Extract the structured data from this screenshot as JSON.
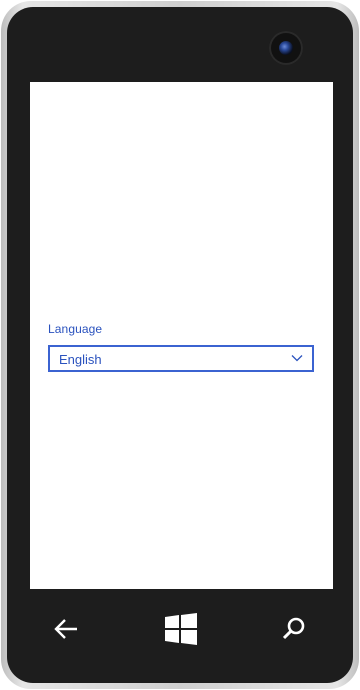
{
  "settings": {
    "language_label": "Language",
    "language_value": "English"
  },
  "icons": {
    "dropdown": "chevron-down-icon",
    "back": "back-arrow-icon",
    "start": "windows-logo-icon",
    "search": "search-icon"
  },
  "colors": {
    "accent": "#2a52be",
    "border": "#3b63d1",
    "bezel": "#1d1d1d"
  }
}
